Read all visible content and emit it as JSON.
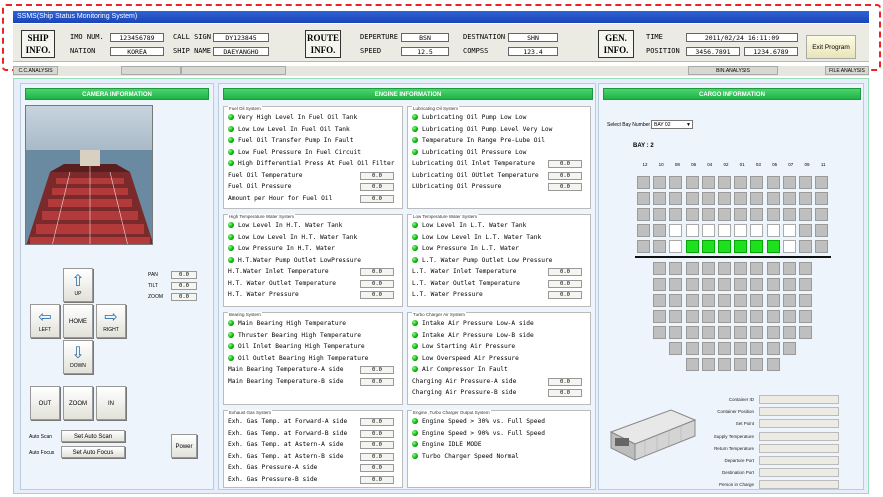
{
  "window_title": "SSMS(Ship Status Monitoring System)",
  "ship_info": {
    "label": "SHIP INFO.",
    "imo_label": "IMO NUM.",
    "imo_value": "123456789",
    "nation_label": "NATION",
    "nation_value": "KOREA",
    "callsign_label": "CALL SIGN",
    "callsign_value": "DY123845",
    "shipname_label": "SHIP NAME",
    "shipname_value": "DAEYANGHO"
  },
  "route_info": {
    "label": "ROUTE INFO.",
    "departure_label": "DEPERTURE",
    "departure_value": "BSN",
    "destination_label": "DESTNATION",
    "destination_value": "SHN",
    "speed_label": "SPEED",
    "speed_value": "12.5",
    "compass_label": "COMPSS",
    "compass_value": "123.4"
  },
  "gen_info": {
    "label": "GEN. INFO.",
    "time_label": "TIME",
    "time_value": "2011/02/24 16:11:09",
    "position_label": "POSITION",
    "position_lat": "3456.7891",
    "position_lon": "1234.6789"
  },
  "exit_button": "Exit Program",
  "tabs": [
    "C.C.ANALYSIS",
    "",
    "",
    "BIN.ANALYSIS",
    "FILE ANALYSIS"
  ],
  "camera": {
    "title": "CAMERA INFORMATION",
    "pan_label": "PAN",
    "pan_value": "0.0",
    "tilt_label": "TILT",
    "tilt_value": "0.0",
    "zoom_label": "ZOOM",
    "zoom_value": "0.0",
    "up": "UP",
    "left": "LEFT",
    "home": "HOME",
    "right": "RIGHT",
    "down": "DOWN",
    "out": "OUT",
    "zoom": "ZOOM",
    "in": "IN",
    "auto_scan_label": "Auto Scan",
    "set_auto_scan": "Set Auto Scan",
    "auto_focus_label": "Auto Focus",
    "set_auto_focus": "Set Auto Focus",
    "power": "Power"
  },
  "engine": {
    "title": "ENGINE INFORMATION",
    "fuel": {
      "title": "Fuel Oil System",
      "alarms": [
        "Very High Level In Fuel Oil Tank",
        "Low Low Level In Fuel Oil Tank",
        "Fuel Oil Transfer Pump In Fault",
        "Low Fuel Pressure In Fuel Circuit",
        "High Differential Press At Fuel Oil Filter"
      ],
      "values": [
        {
          "label": "Fuel Oil Temperature",
          "value": "0.0"
        },
        {
          "label": "Fuel Oil Pressure",
          "value": "0.0"
        },
        {
          "label": "Amount per Hour for Fuel Oil",
          "value": "0.0"
        }
      ]
    },
    "lube": {
      "title": "Lubricating Oil System",
      "alarms": [
        "Lubricating Oil Pump Low Low",
        "Lubricating Oil Pump Level Very Low",
        "Temperature In Range Pre-Lube Oil",
        "Lubricating Oil Pressure Low"
      ],
      "values": [
        {
          "label": "Lubricating Oil Inlet Temperature",
          "value": "0.0"
        },
        {
          "label": "Lubricating Oil OUtlet Temperature",
          "value": "0.0"
        },
        {
          "label": "LUbricating Oil Pressure",
          "value": "0.0"
        }
      ]
    },
    "ht": {
      "title": "High Temperature Water System",
      "alarms": [
        "Low Level In H.T. Water Tank",
        "Low Low Level In H.T. Water Tank",
        "Low Pressure In H.T. Water",
        "H.T.Water Pump Outlet LowPressure"
      ],
      "values": [
        {
          "label": "H.T.Water Inlet Temperature",
          "value": "0.0"
        },
        {
          "label": "H.T. Water Outlet Temperature",
          "value": "0.0"
        },
        {
          "label": "H.T. Water Pressure",
          "value": "0.0"
        }
      ]
    },
    "lt": {
      "title": "Low Temperature Water System",
      "alarms": [
        "Low Level In L.T. Water Tank",
        "Low Low Level In L.T. Water Tank",
        "Low Pressure In L.T. Water",
        "L.T. Water Pump Outlet Low Pressure"
      ],
      "values": [
        {
          "label": "L.T. Water Inlet Temperature",
          "value": "0.0"
        },
        {
          "label": "L.T. Water Outlet Temperature",
          "value": "0.0"
        },
        {
          "label": "L.T. Water Pressure",
          "value": "0.0"
        }
      ]
    },
    "bearing": {
      "title": "Bearing System",
      "alarms": [
        "Main Bearing High Temperature",
        "Thruster Bearing High Temperature",
        "Oil Inlet Bearing High Temperature",
        "Oil Outlet Bearing High Temperature"
      ],
      "values": [
        {
          "label": "Main Bearing Temperature-A side",
          "value": "0.0"
        },
        {
          "label": "Main Bearing Temperature-B side",
          "value": "0.0"
        }
      ]
    },
    "turbo": {
      "title": "Turbo Charger Air System",
      "alarms": [
        "Intake Air Pressure Low-A side",
        "Intake Air Pressure Low-B side",
        "Low Starting Air Pressure",
        "Low Overspeed Air Pressure",
        "Air Compressor In Fault"
      ],
      "values": [
        {
          "label": "Charging Air Pressure-A side",
          "value": "0.0"
        },
        {
          "label": "Charging Air Pressure-B side",
          "value": "0.0"
        }
      ]
    },
    "exhaust": {
      "title": "Exhaust Gas System",
      "values": [
        {
          "label": "Exh. Gas Temp. at Forward-A side",
          "value": "0.0"
        },
        {
          "label": "Exh. Gas Temp. at Forward-B side",
          "value": "0.0"
        },
        {
          "label": "Exh. Gas Temp. at Astern-A side",
          "value": "0.0"
        },
        {
          "label": "Exh. Gas Temp. at Astern-B side",
          "value": "0.0"
        },
        {
          "label": "Exh. Gas Pressure-A side",
          "value": "0.0"
        },
        {
          "label": "Exh. Gas Pressure-B side",
          "value": "0.0"
        }
      ]
    },
    "output": {
      "title": "Engine ,Turbo Charger Output System",
      "alarms": [
        "Engine Speed > 30% vs. Full Speed",
        "Engine Speed > 90% vs. Full Speed",
        "Engine IDLE MODE",
        "Turbo Charger Speed Normal"
      ]
    }
  },
  "cargo": {
    "title": "CARGO INFORMATION",
    "bay_select_label": "Select Bay Number",
    "bay_select_value": "BAY 02",
    "bay_label": "BAY : 2",
    "columns": [
      "12",
      "10",
      "08",
      "06",
      "04",
      "02",
      "01",
      "03",
      "05",
      "07",
      "09",
      "11"
    ],
    "fields": [
      "Container ID",
      "Container Position",
      "Set Point",
      "Supply Temperature",
      "Return Temperature",
      "Departure Port",
      "Destination Port",
      "Person in Charge"
    ]
  },
  "colors": {
    "accent_green": "#21b247",
    "title_blue": "#1a44b8",
    "lamp_green": "#00aa00"
  }
}
